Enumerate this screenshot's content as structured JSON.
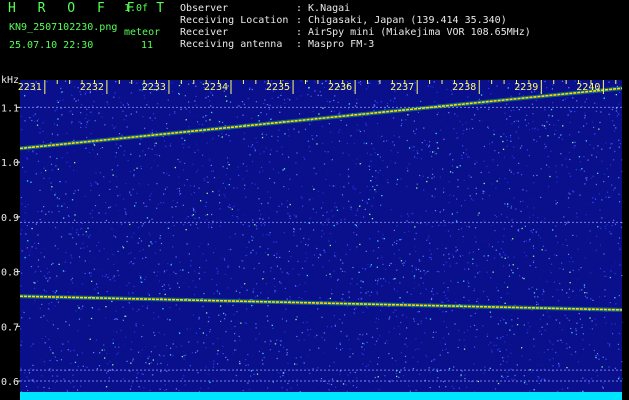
{
  "header": {
    "brand": "H R O F F T",
    "version": "1.0f",
    "filename": "KN9_2507102230.png",
    "station_code": "meteor",
    "datetime": "25.07.10 22:30",
    "count": "11",
    "info": [
      {
        "label": "Observer",
        "value": ": K.Nagai"
      },
      {
        "label": "Receiving Location",
        "value": ": Chigasaki, Japan (139.414 35.340)"
      },
      {
        "label": "Receiver",
        "value": ": AirSpy mini (Miakejima VOR 108.65MHz)"
      },
      {
        "label": "Receiving antenna",
        "value": ": Maspro FM-3"
      }
    ]
  },
  "axis": {
    "unit": "kHz",
    "y_ticks": [
      "1.1",
      "1.0",
      "0.9",
      "0.8",
      "0.7",
      "0.6"
    ],
    "x_ticks": [
      "2231",
      "2232",
      "2233",
      "2234",
      "2235",
      "2236",
      "2237",
      "2238",
      "2239",
      "2240"
    ]
  },
  "colors": {
    "background": "#000000",
    "spectrogram": "#0a0f8c",
    "signal": "#ffdd00",
    "label_green": "#55ff55",
    "tick_yellow": "#ffff66",
    "baseline": "#00e5ff"
  },
  "spectrogram": {
    "y_range_khz": [
      0.58,
      1.15
    ],
    "x_range": [
      2230.6,
      2240.3
    ],
    "traces": [
      {
        "from": [
          2230.6,
          1.025
        ],
        "to": [
          2240.3,
          1.135
        ]
      },
      {
        "from": [
          2230.6,
          0.755
        ],
        "to": [
          2240.3,
          0.73
        ]
      }
    ],
    "horizontal_lines_khz": [
      1.1,
      0.89,
      0.62,
      0.6
    ]
  }
}
